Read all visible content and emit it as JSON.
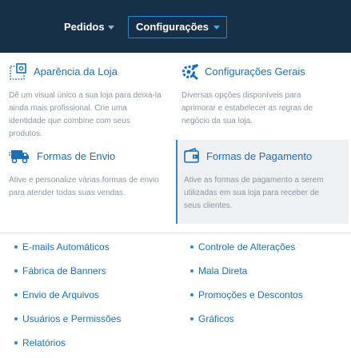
{
  "nav": {
    "pedidos": "Pedidos",
    "configuracoes": "Configurações"
  },
  "cards": {
    "aparencia": {
      "title": "Aparência da Loja",
      "lines": [
        "Dê um visual único a sua loja para deixá-la",
        "ainda mais profissional. Crie uma",
        "identidade que combine com seus",
        "produtos."
      ]
    },
    "gerais": {
      "title": "Configurações Gerais",
      "lines": [
        "Diversas opções disponíveis para",
        "aprimorar e estabelecer as regras de",
        "negócio da sua loja."
      ]
    },
    "envio": {
      "title": "Formas de Envio",
      "lines": [
        "Ative e personalize várias formas de envio",
        "para atender todas suas vendas."
      ]
    },
    "pagamento": {
      "title": "Formas de Pagamento",
      "lines": [
        "Ative as formas de pagamento a serem",
        "utilizadas em sua loja para receber de",
        "seus clientes."
      ]
    }
  },
  "links": {
    "left": [
      "E-mails Automáticos",
      "Fábrica de Banners",
      "Envio de Arquivos",
      "Usuários e Permissões",
      "Relatórios"
    ],
    "right": [
      "Controle de Alterações",
      "Mala Direta",
      "Promoções e Descontos",
      "Gráficos"
    ]
  },
  "colors": {
    "topbar": "#17304a",
    "accent": "#2d87c7",
    "link": "#1d6fb4",
    "muted": "#8a97a3"
  }
}
